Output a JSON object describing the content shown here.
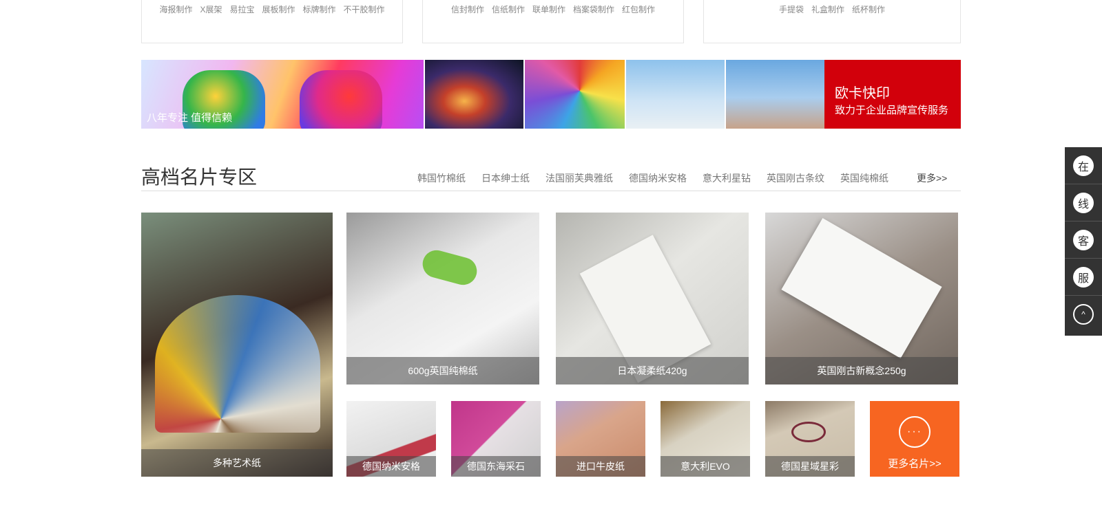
{
  "top_categories": [
    {
      "links": [
        "海报制作",
        "X展架",
        "易拉宝",
        "展板制作",
        "标牌制作",
        "不干胶制作"
      ]
    },
    {
      "links": [
        "信封制作",
        "信纸制作",
        "联单制作",
        "档案袋制作",
        "红包制作"
      ]
    },
    {
      "links": [
        "手提袋",
        "礼盒制作",
        "纸杯制作"
      ]
    }
  ],
  "banner": {
    "caption": "八年专注 值得信赖",
    "brand_title": "欧卡快印",
    "brand_slogan": "致力于企业品牌宣传服务",
    "brand_color": "#d2000b"
  },
  "section": {
    "title": "高档名片专区",
    "tabs": [
      "韩国竹棉纸",
      "日本绅士纸",
      "法国丽芙典雅纸",
      "德国纳米安格",
      "意大利星钻",
      "英国刚古条纹",
      "英国纯棉纸"
    ],
    "more": "更多>>"
  },
  "products": {
    "featured": {
      "label": "多种艺术纸"
    },
    "large": [
      {
        "label": "600g英国纯棉纸"
      },
      {
        "label": "日本凝柔纸420g"
      },
      {
        "label": "英国刚古新概念250g"
      }
    ],
    "small": [
      {
        "label": "德国纳米安格"
      },
      {
        "label": "德国东海采石"
      },
      {
        "label": "进口牛皮纸"
      },
      {
        "label": "意大利EVO"
      },
      {
        "label": "德国星域星彩"
      }
    ],
    "more_tile": {
      "label": "更多名片>>",
      "icon": "···",
      "color": "#f76521"
    }
  },
  "side_service": {
    "chars": [
      "在",
      "线",
      "客",
      "服"
    ],
    "top_icon": "^"
  }
}
